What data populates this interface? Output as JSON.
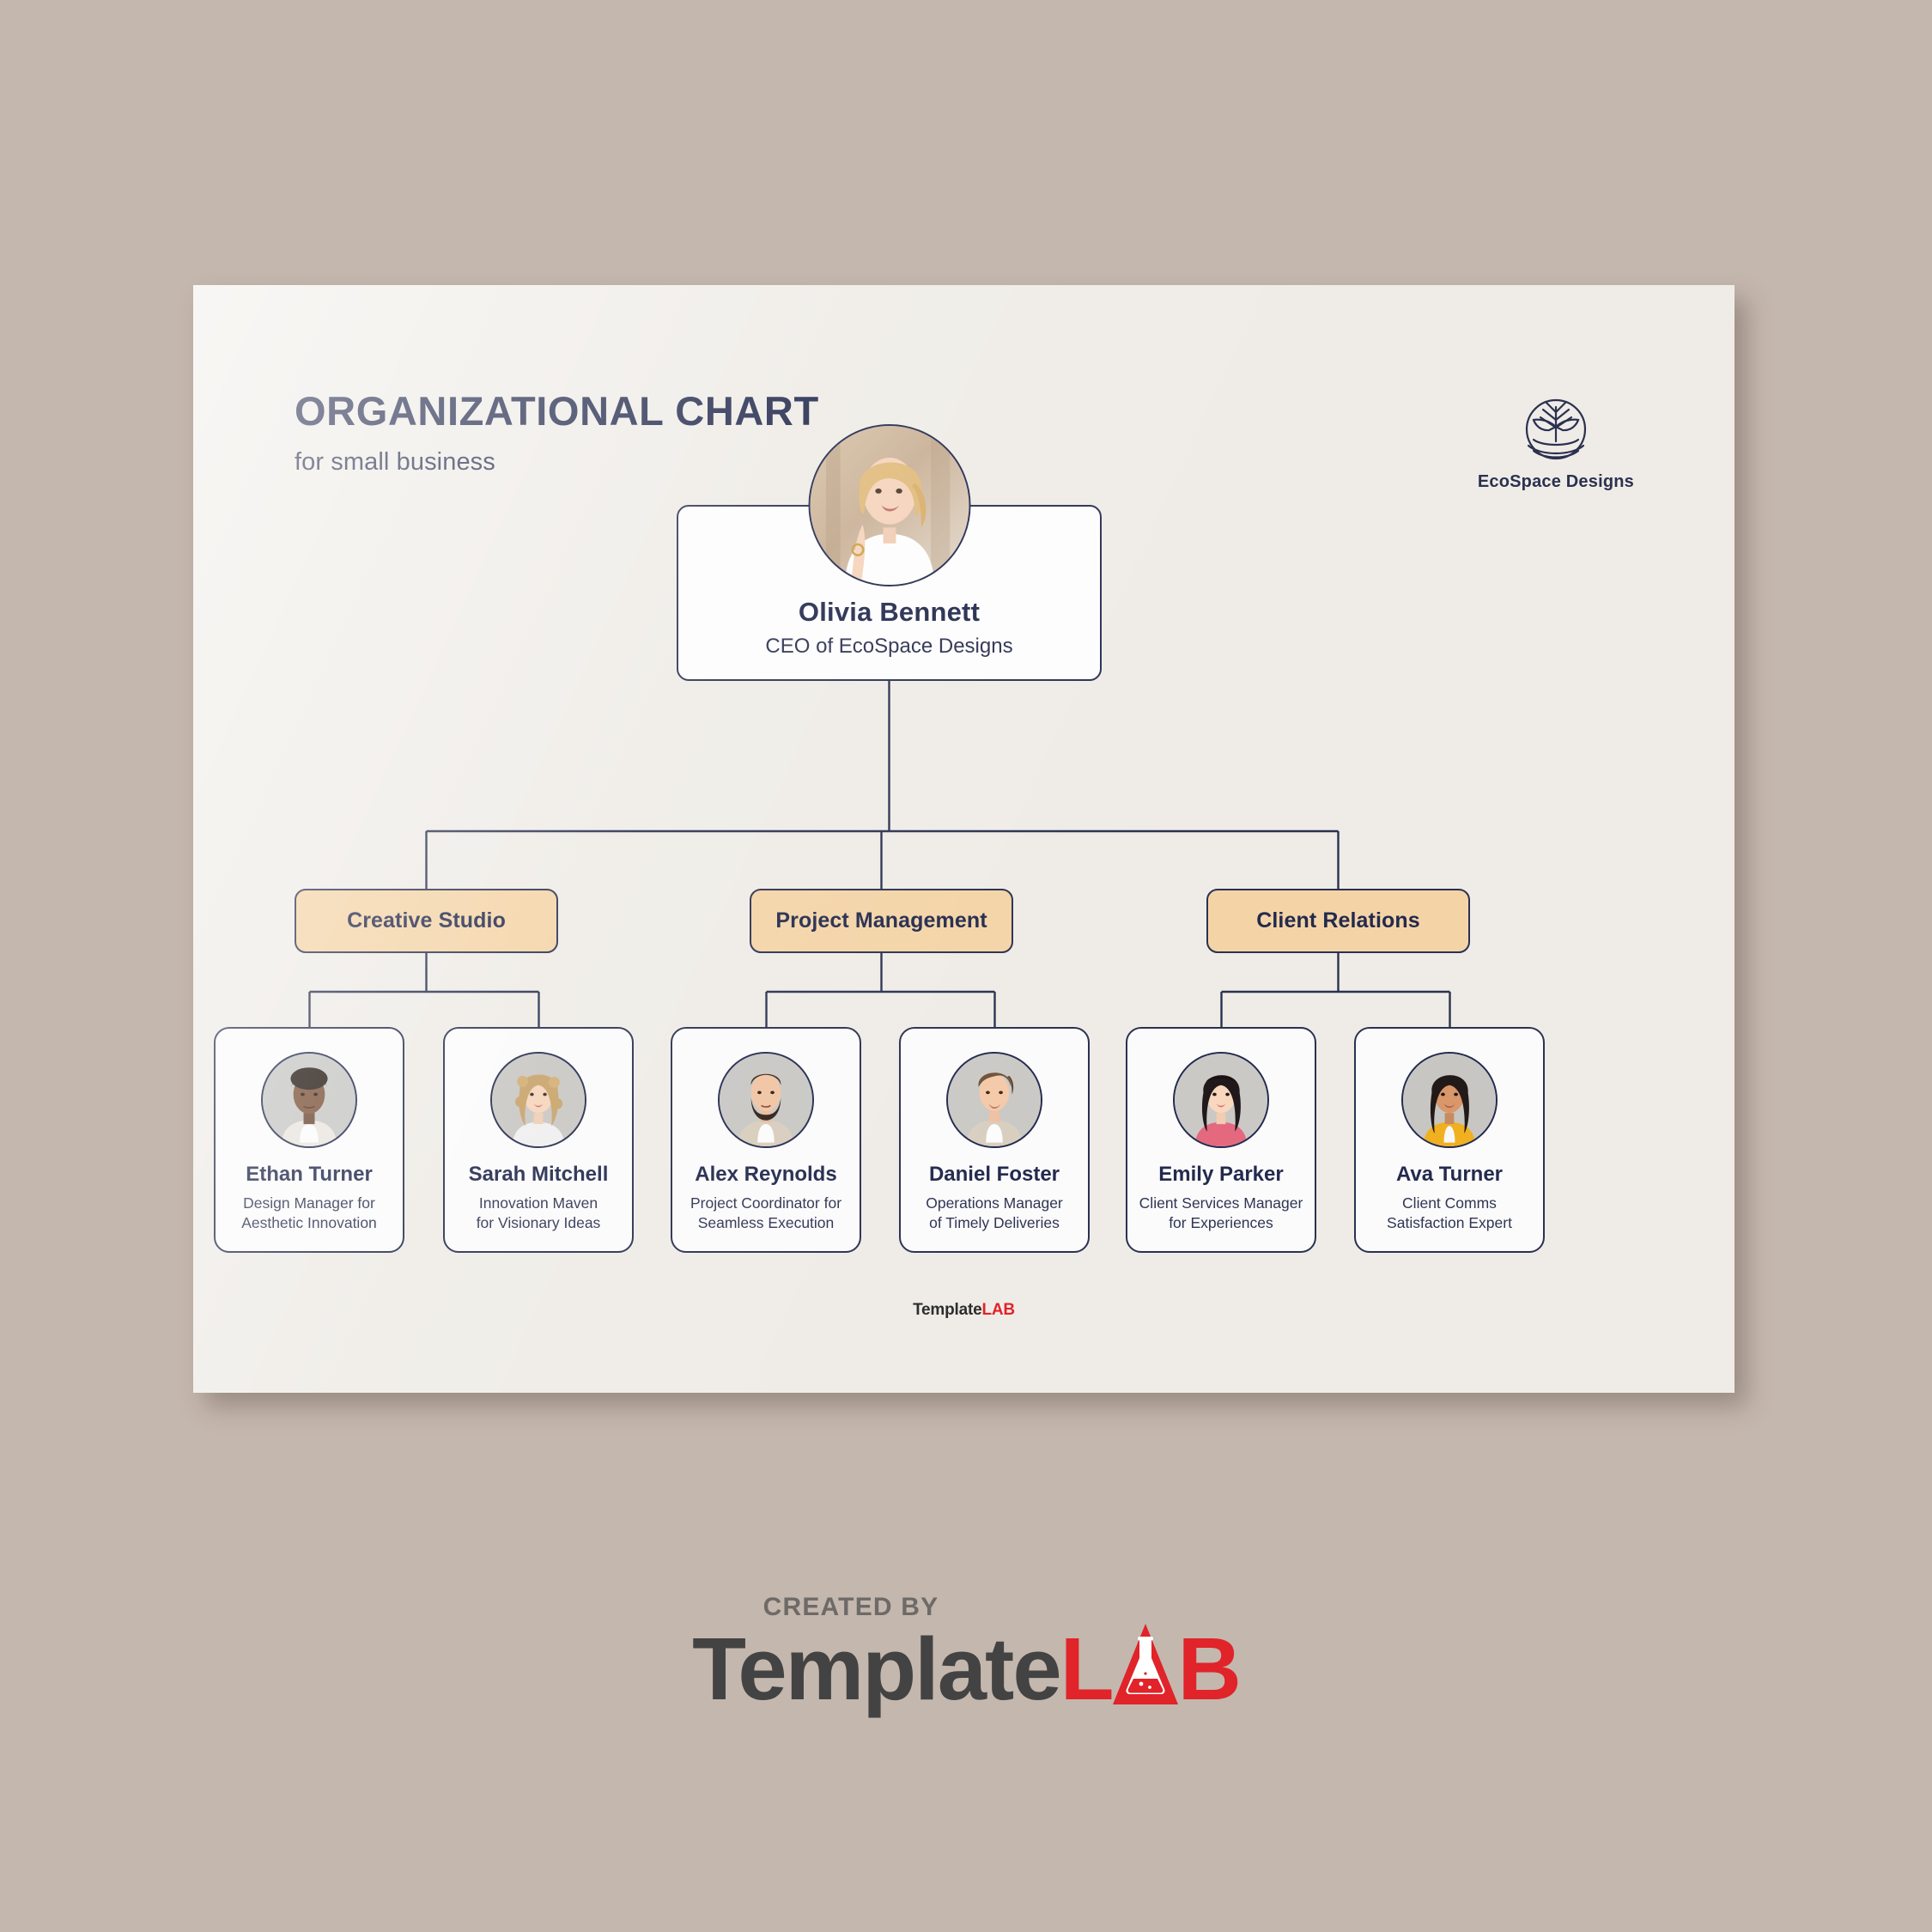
{
  "document": {
    "title": "ORGANIZATIONAL CHART",
    "subtitle": "for small business",
    "brand_name": "EcoSpace Designs",
    "brand_icon": "tree-plant-icon",
    "page_color": "#efece7",
    "background_color": "#c4b7ae",
    "accent_color": "#f4d4a7",
    "ink_color": "#232a4d"
  },
  "chart_data": {
    "type": "org-chart",
    "title": "ORGANIZATIONAL CHART",
    "subtitle": "for small business",
    "root": {
      "name": "Olivia Bennett",
      "role": "CEO of EcoSpace Designs",
      "avatar": "photo-olivia-bennett"
    },
    "departments": [
      {
        "label": "Creative Studio",
        "members": [
          {
            "name": "Ethan Turner",
            "role": "Design Manager for\nAesthetic Innovation",
            "avatar": "photo-ethan-turner"
          },
          {
            "name": "Sarah Mitchell",
            "role": "Innovation Maven\nfor Visionary Ideas",
            "avatar": "photo-sarah-mitchell"
          }
        ]
      },
      {
        "label": "Project Management",
        "members": [
          {
            "name": "Alex Reynolds",
            "role": "Project Coordinator for\nSeamless Execution",
            "avatar": "photo-alex-reynolds"
          },
          {
            "name": "Daniel Foster",
            "role": "Operations Manager\nof Timely Deliveries",
            "avatar": "photo-daniel-foster"
          }
        ]
      },
      {
        "label": "Client Relations",
        "members": [
          {
            "name": "Emily Parker",
            "role": "Client Services Manager\nfor Experiences",
            "avatar": "photo-emily-parker"
          },
          {
            "name": "Ava Turner",
            "role": "Client Comms\nSatisfaction Expert",
            "avatar": "photo-ava-turner"
          }
        ]
      }
    ]
  },
  "inner_mark": {
    "template": "Template",
    "lab": "LAB"
  },
  "watermark": {
    "created_by": "CREATED BY",
    "template": "Template",
    "l": "L",
    "a_icon": "flask-icon",
    "b": "B"
  }
}
